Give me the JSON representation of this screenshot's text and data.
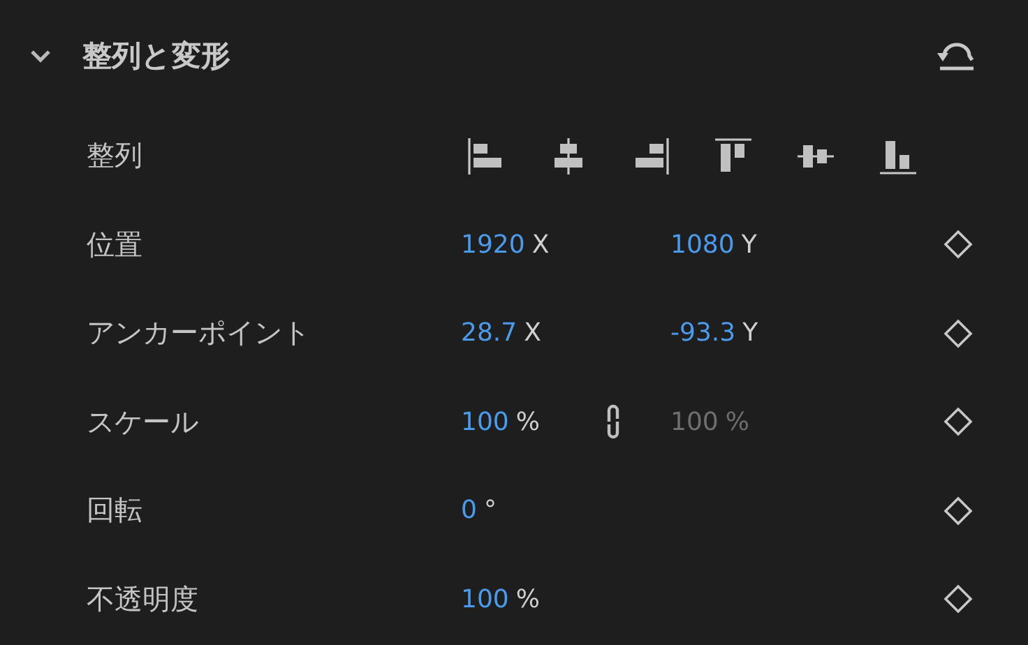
{
  "section": {
    "title": "整列と変形",
    "expanded": true
  },
  "rows": [
    {
      "kind": "align",
      "label": "整列",
      "buttons": [
        {
          "kind": "left"
        },
        {
          "kind": "center-h"
        },
        {
          "kind": "right"
        },
        {
          "kind": "top"
        },
        {
          "kind": "middle-v"
        },
        {
          "kind": "bottom"
        }
      ]
    },
    {
      "kind": "property",
      "label": "位置",
      "values": [
        {
          "value": "1920",
          "unit": "X",
          "disabled": false
        },
        {
          "value": "1080",
          "unit": "Y",
          "disabled": false
        }
      ]
    },
    {
      "kind": "property",
      "label": "アンカーポイント",
      "values": [
        {
          "value": "28.7",
          "unit": "X",
          "disabled": false
        },
        {
          "value": "-93.3",
          "unit": "Y",
          "disabled": false
        }
      ]
    },
    {
      "kind": "property",
      "label": "スケール",
      "linked": true,
      "values": [
        {
          "value": "100",
          "unit": "%",
          "disabled": false
        },
        {
          "value": "100",
          "unit": "%",
          "disabled": true
        }
      ]
    },
    {
      "kind": "property",
      "label": "回転",
      "values": [
        {
          "value": "0",
          "unit": "°",
          "disabled": false
        }
      ]
    },
    {
      "kind": "property",
      "label": "不透明度",
      "values": [
        {
          "value": "100",
          "unit": "%",
          "disabled": false
        }
      ]
    }
  ]
}
